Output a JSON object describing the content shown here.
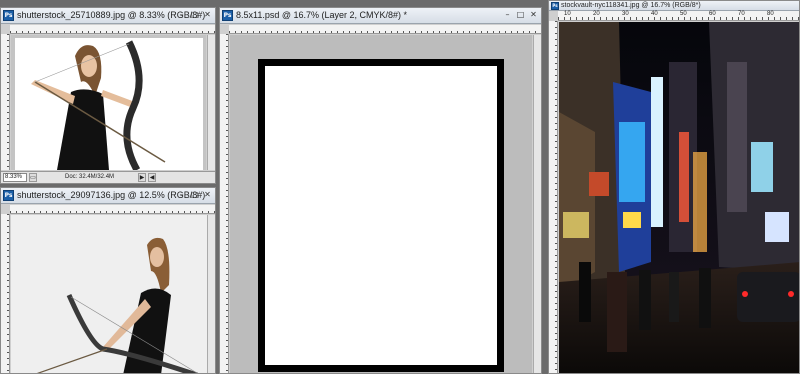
{
  "app_icon": {
    "glyph": "Ps"
  },
  "window_controls": {
    "minimize": "–",
    "maximize": "□",
    "close": "✕"
  },
  "windows": {
    "archer1": {
      "title": "shutterstock_25710889.jpg @ 8.33% (RGB/8#)",
      "zoom": "8.33%",
      "doc_info": "Doc: 32.4M/32.4M"
    },
    "archer2": {
      "title": "shutterstock_29097136.jpg @ 12.5% (RGB/8#)"
    },
    "document": {
      "title": "8.5x11.psd @ 16.7% (Layer 2, CMYK/8#) *"
    },
    "city": {
      "title": "stockvault-nyc118341.jpg @ 16.7% (RGB/8*)",
      "ruler_labels": [
        "10",
        "20",
        "30",
        "40",
        "50",
        "60",
        "70",
        "80"
      ]
    }
  },
  "colors": {
    "title_gradient_top": "#eef2f7",
    "ps_icon_blue": "#1b5fa8",
    "canvas_gray": "#b8b8b8",
    "frame_black": "#000000"
  }
}
